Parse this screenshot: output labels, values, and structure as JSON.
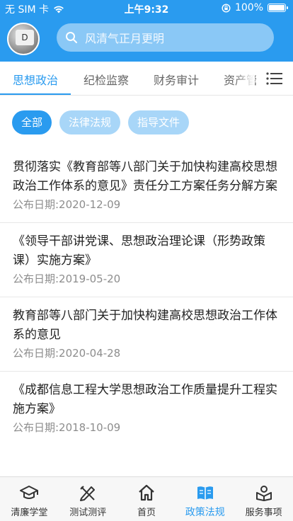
{
  "status_bar": {
    "carrier": "无 SIM 卡",
    "time": "上午9:32",
    "battery": "100%",
    "battery_level": 1.0
  },
  "search": {
    "placeholder": "风清气正月更明"
  },
  "tabs": [
    {
      "label": "思想政治",
      "active": true
    },
    {
      "label": "纪检监察",
      "active": false
    },
    {
      "label": "财务审计",
      "active": false
    },
    {
      "label": "资产管",
      "active": false
    }
  ],
  "chips": [
    {
      "label": "全部",
      "active": true
    },
    {
      "label": "法律法规",
      "active": false
    },
    {
      "label": "指导文件",
      "active": false
    }
  ],
  "list": [
    {
      "title": "贯彻落实《教育部等八部门关于加快构建高校思想政治工作体系的意见》责任分工方案任务分解方案",
      "date": "公布日期:2020-12-09"
    },
    {
      "title": "《领导干部讲党课、思想政治理论课（形势政策课）实施方案》",
      "date": "公布日期:2019-05-20"
    },
    {
      "title": "教育部等八部门关于加快构建高校思想政治工作体系的意见",
      "date": "公布日期:2020-04-28"
    },
    {
      "title": "《成都信息工程大学思想政治工作质量提升工程实施方案》",
      "date": "公布日期:2018-10-09"
    }
  ],
  "bottom_nav": [
    {
      "label": "清廉学堂",
      "icon": "graduation-cap-icon",
      "active": false
    },
    {
      "label": "测试测评",
      "icon": "pencil-ruler-icon",
      "active": false
    },
    {
      "label": "首页",
      "icon": "home-icon",
      "active": false
    },
    {
      "label": "政策法规",
      "icon": "book-icon",
      "active": true
    },
    {
      "label": "服务事项",
      "icon": "service-icon",
      "active": false
    }
  ],
  "colors": {
    "accent": "#2a9bef",
    "chip_inactive": "#a8d6f8",
    "date_text": "#8d8d8d"
  }
}
